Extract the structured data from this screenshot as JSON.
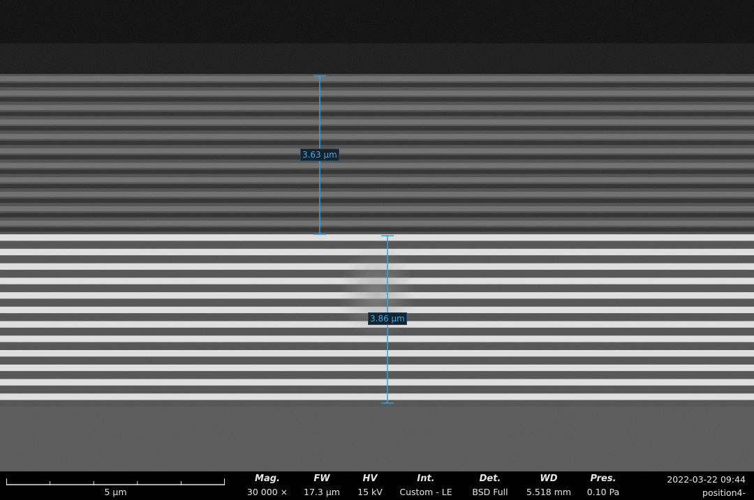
{
  "image": {
    "type": "SEM cross-section micrograph",
    "colors": {
      "void": "#060606",
      "upper_stack_base": "#4a4a4a",
      "upper_stack_bright": "#6b6b6b",
      "upper_stack_dark": "#2a2a2a",
      "lower_stack_bright": "#e2e2e2",
      "lower_stack_dark": "#4e4e4e",
      "substrate": "#545454",
      "measure_line": "#3a9ee0"
    },
    "upper_stack_periods": 11,
    "lower_stack_periods": 12
  },
  "measurements": [
    {
      "label": "3.63 µm"
    },
    {
      "label": "3.86 µm"
    }
  ],
  "databar": {
    "scale_bar_label": "5 µm",
    "fields": [
      {
        "label": "Mag.",
        "value": "30 000 ×"
      },
      {
        "label": "FW",
        "value": "17.3 µm"
      },
      {
        "label": "HV",
        "value": "15 kV"
      },
      {
        "label": "Int.",
        "value": "Custom - LE"
      },
      {
        "label": "Det.",
        "value": "BSD Full"
      },
      {
        "label": "WD",
        "value": "5.518 mm"
      },
      {
        "label": "Pres.",
        "value": "0.10 Pa"
      }
    ],
    "timestamp": "2022-03-22 09:44",
    "image_name": "position4-"
  }
}
